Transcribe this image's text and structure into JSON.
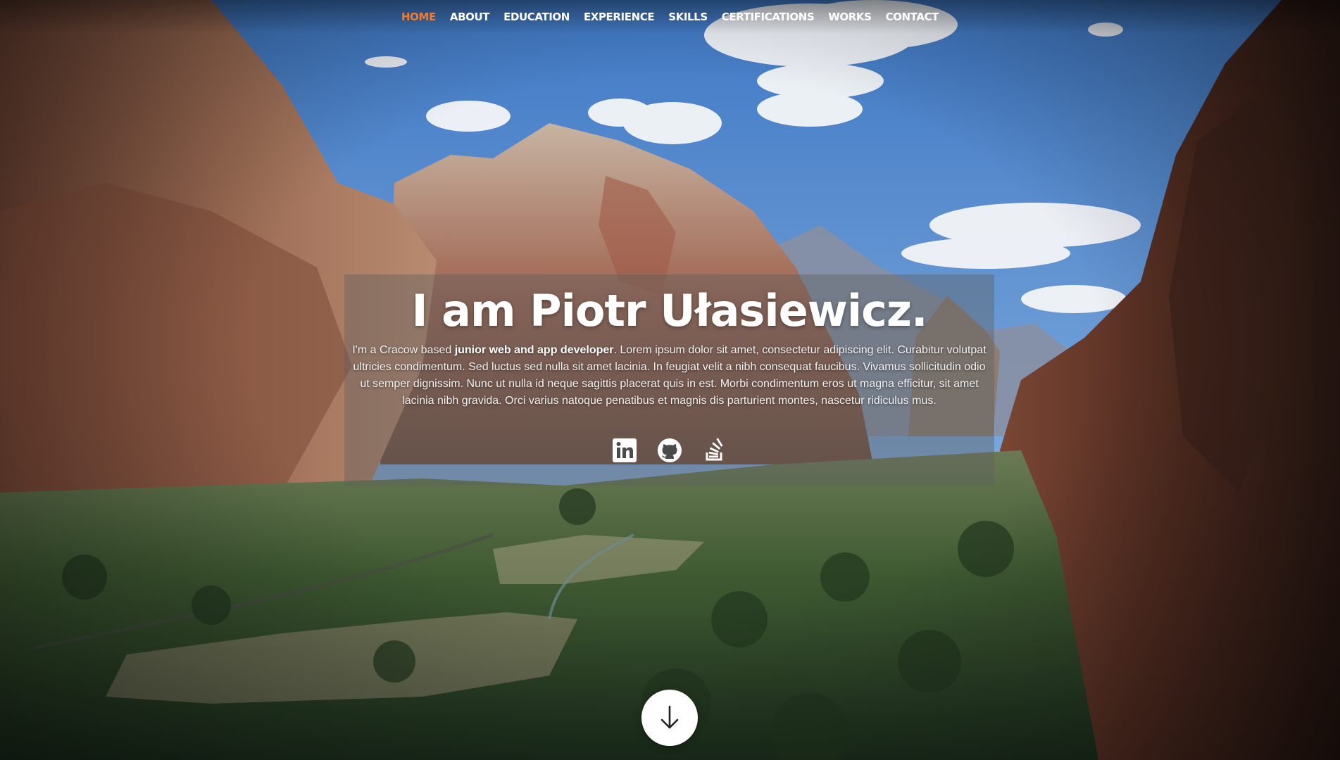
{
  "nav": {
    "items": [
      {
        "label": "HOME",
        "active": true
      },
      {
        "label": "ABOUT"
      },
      {
        "label": "EDUCATION"
      },
      {
        "label": "EXPERIENCE"
      },
      {
        "label": "SKILLS"
      },
      {
        "label": "CERTIFICATIONS"
      },
      {
        "label": "WORKS"
      },
      {
        "label": "CONTACT"
      }
    ],
    "active_color": "#ef7d2f"
  },
  "intro": {
    "title": "I am Piotr Ułasiewicz.",
    "text_before": "I'm a Cracow based ",
    "text_bold": "junior web and app developer",
    "text_after": ". Lorem ipsum dolor sit amet, consectetur adipiscing elit. Curabitur volutpat ultricies condimentum. Sed luctus sed nulla sit amet lacinia. In feugiat velit a nibh consequat faucibus. Vivamus sollicitudin odio ut semper dignissim. Nunc ut nulla id neque sagittis placerat quis in est. Morbi condimentum eros ut magna efficitur, sit amet lacinia nibh gravida. Orci varius natoque penatibus et magnis dis parturient montes, nascetur ridiculus mus."
  },
  "social": [
    {
      "icon": "linkedin-icon"
    },
    {
      "icon": "github-icon"
    },
    {
      "icon": "stackoverflow-icon"
    }
  ],
  "scroll": {
    "icon": "arrow-down-icon"
  }
}
